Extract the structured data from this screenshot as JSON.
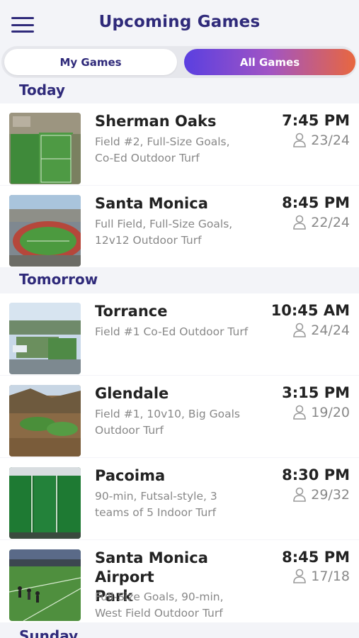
{
  "header": {
    "title": "Upcoming Games",
    "menu_icon": "hamburger-menu-icon"
  },
  "tabs": {
    "my_games": "My Games",
    "all_games": "All Games",
    "active": "All Games"
  },
  "colors": {
    "brand": "#2f2a7a",
    "gradient_start": "#5a3fe0",
    "gradient_end": "#e8673f",
    "muted": "#888888"
  },
  "sections": [
    {
      "label": "Today"
    },
    {
      "label": "Tomorrow"
    },
    {
      "label": "Sunday"
    }
  ],
  "games": [
    {
      "location": "Sherman Oaks",
      "desc1": "Field #2, Full-Size Goals,",
      "desc2": "Co-Ed Outdoor Turf",
      "time": "7:45 PM",
      "spots": "23/24"
    },
    {
      "location": "Santa Monica",
      "desc1": "Full Field, Full-Size Goals,",
      "desc2": "12v12 Outdoor Turf",
      "time": "8:45 PM",
      "spots": "22/24"
    },
    {
      "location": "Torrance",
      "desc1": "Field #1 Co-Ed Outdoor Turf",
      "desc2": "",
      "time": "10:45 AM",
      "spots": "24/24"
    },
    {
      "location": "Glendale",
      "desc1": "Field #1, 10v10, Big Goals",
      "desc2": "Outdoor Turf",
      "time": "3:15 PM",
      "spots": "19/20"
    },
    {
      "location": "Pacoima",
      "desc1": "90-min, Futsal-style, 3",
      "desc2": "teams of 5 Indoor Turf",
      "time": "8:30 PM",
      "spots": "29/32"
    },
    {
      "location_line1": "Santa Monica Airport",
      "location_line2": "Park",
      "desc1": "Full-Size Goals, 90-min,",
      "desc2": "West Field Outdoor Turf",
      "time": "8:45 PM",
      "spots": "17/18"
    }
  ]
}
